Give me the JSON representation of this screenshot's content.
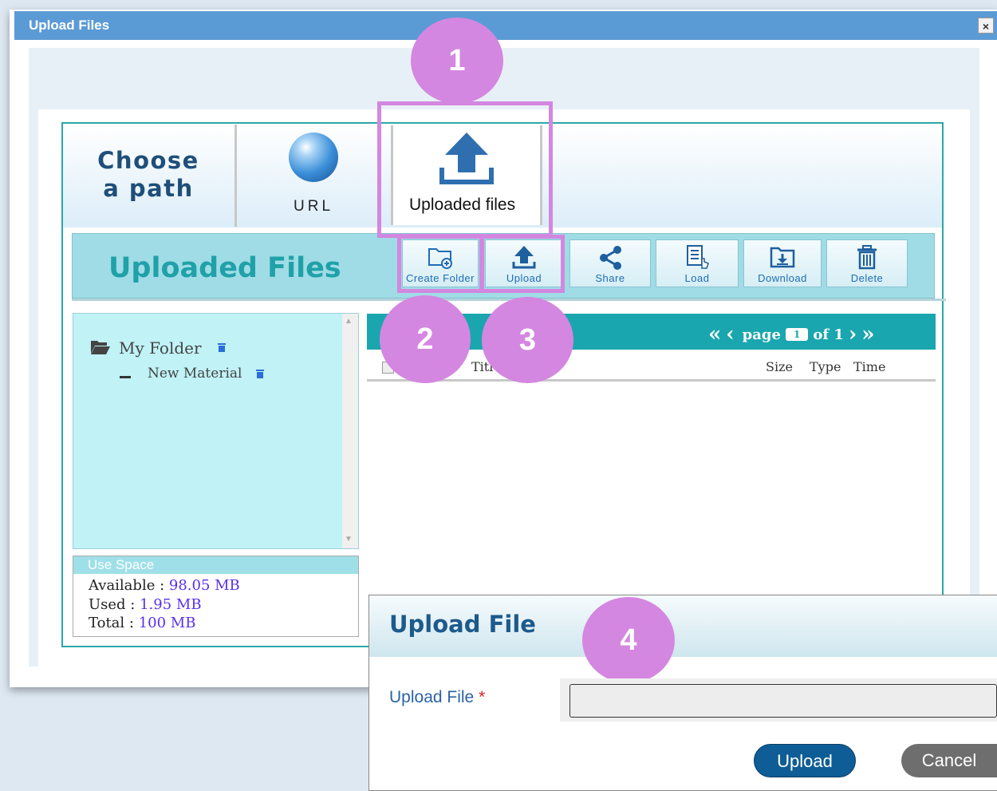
{
  "dialog": {
    "title": "Upload Files",
    "close_icon": "×"
  },
  "tabs": {
    "choose_path": "Choose a path",
    "url": "URL",
    "uploaded_files": "Uploaded files"
  },
  "toolbar": {
    "title": "Uploaded Files",
    "buttons": [
      {
        "label": "Create Folder",
        "icon": "folder-plus-icon"
      },
      {
        "label": "Upload",
        "icon": "upload-icon"
      },
      {
        "label": "Share",
        "icon": "share-icon"
      },
      {
        "label": "Load",
        "icon": "load-icon"
      },
      {
        "label": "Download",
        "icon": "download-icon"
      },
      {
        "label": "Delete",
        "icon": "trash-icon"
      }
    ]
  },
  "tree": {
    "root": "My Folder",
    "children": [
      "New Material"
    ]
  },
  "use_space": {
    "title": "Use Space",
    "available_label": "Available :",
    "available_value": "98.05 MB",
    "used_label": "Used :",
    "used_value": "1.95 MB",
    "total_label": "Total :",
    "total_value": "100 MB"
  },
  "list": {
    "pager": {
      "first": "«",
      "prev": "‹",
      "page_label": "page",
      "page_value": "1",
      "of_label": "of 1",
      "next": "›",
      "last": "»"
    },
    "columns": {
      "title": "Titl",
      "size": "Size",
      "type": "Type",
      "time": "Time"
    }
  },
  "callouts": [
    "1",
    "2",
    "3",
    "4"
  ],
  "modal": {
    "title": "Upload File",
    "field_label": "Upload File",
    "required_mark": "*",
    "upload_button": "Upload",
    "cancel_button": "Cancel"
  },
  "colors": {
    "title_bar": "#5b9bd5",
    "teal": "#1aa6ae",
    "callout": "#d387e0",
    "primary_button": "#0f5d96"
  }
}
